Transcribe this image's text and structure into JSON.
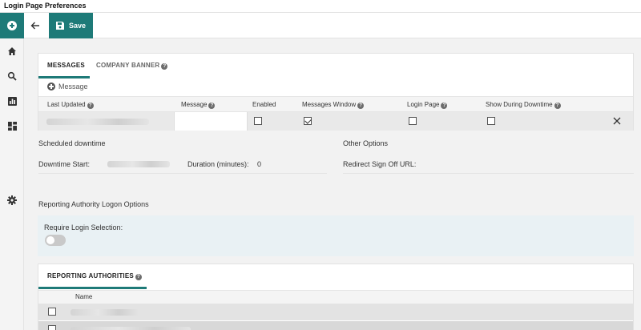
{
  "window": {
    "title": "Login Page Preferences"
  },
  "nav": {
    "icons": [
      "plus-circle-icon",
      "home-icon",
      "search-icon",
      "bar-chart-icon",
      "dashboard-icon",
      "gear-icon"
    ]
  },
  "toolbar": {
    "save_label": "Save"
  },
  "messages": {
    "tabs": [
      {
        "label": "MESSAGES",
        "active": true
      },
      {
        "label": "COMPANY BANNER",
        "active": false
      }
    ],
    "add_label": "Message",
    "columns": [
      "Last Updated",
      "Message",
      "Enabled",
      "Messages Window",
      "Login Page",
      "Show During Downtime"
    ],
    "row": {
      "enabled": false,
      "messages_window": true,
      "login_page": false,
      "show_during_downtime": false
    }
  },
  "downtime": {
    "title": "Scheduled downtime",
    "start_label": "Downtime Start:",
    "duration_label": "Duration (minutes):",
    "duration_value": "0"
  },
  "other_options": {
    "title": "Other Options",
    "redirect_label": "Redirect Sign Off URL:"
  },
  "logon_options": {
    "title": "Reporting Authority Logon Options",
    "require_label": "Require Login Selection:",
    "require_value": false
  },
  "authorities": {
    "tab_label": "REPORTING AUTHORITIES",
    "column": "Name"
  },
  "colors": {
    "accent": "#1e7a78",
    "info_panel": "#e9f1f4"
  }
}
